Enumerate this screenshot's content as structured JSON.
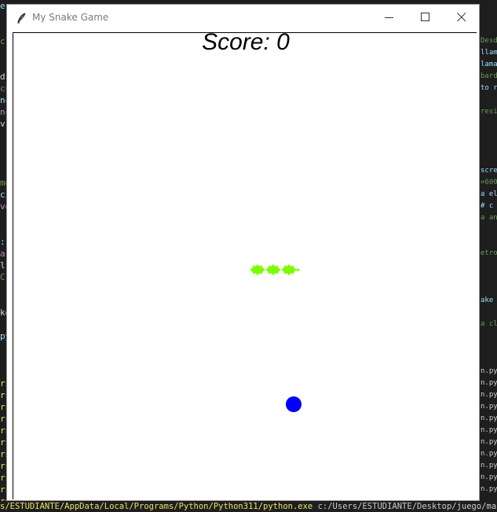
{
  "window": {
    "title": "My Snake Game",
    "app_icon": "feather-icon",
    "controls": [
      "minimize-icon",
      "maximize-icon",
      "close-icon"
    ]
  },
  "game": {
    "score_text": "Score: 0",
    "snake_color": "#7CFC00",
    "food_color": "#0000FF",
    "background_color": "#FFFFFF",
    "snake_segments": 3,
    "direction": "right"
  },
  "background_terminal": {
    "command_prefix": "s/ESTUDIANTE/AppData/Local/Programs/Python/Python311/python.exe",
    "command_arg": "c:/Users/ESTUDIANTE/Desktop/juego/main.py",
    "left_fragments": [
      "e",
      "",
      "",
      "cl",
      "",
      "",
      "d",
      "cu",
      "nc",
      "nc",
      " v",
      "",
      "",
      "",
      "",
      "me",
      "ci",
      "ve",
      "",
      "",
      ":",
      "ar",
      " l",
      " C",
      "",
      "",
      "ke",
      "",
      "py",
      "",
      "",
      "",
      "rs/",
      "rs/",
      "rs/",
      "rs/",
      "rs/",
      "rs/",
      "rs/",
      "rs/",
      "rs/",
      "rs/",
      "rs/"
    ],
    "right_fragments": [
      "",
      "",
      "",
      "Desde",
      "llama",
      "lama",
      "bard",
      "to re",
      "",
      "resia",
      "",
      "",
      "",
      "",
      "scre",
      "=600",
      "a el",
      " # c",
      "a ani",
      "",
      "",
      "etros",
      "",
      "",
      "",
      "ake",
      "",
      "a cl",
      "",
      "",
      "",
      "n.py",
      "n.py",
      "n.py",
      "n.py",
      "n.py",
      "n.py",
      "n.py",
      "n.py",
      "n.py",
      "n.py",
      "n.py"
    ]
  }
}
